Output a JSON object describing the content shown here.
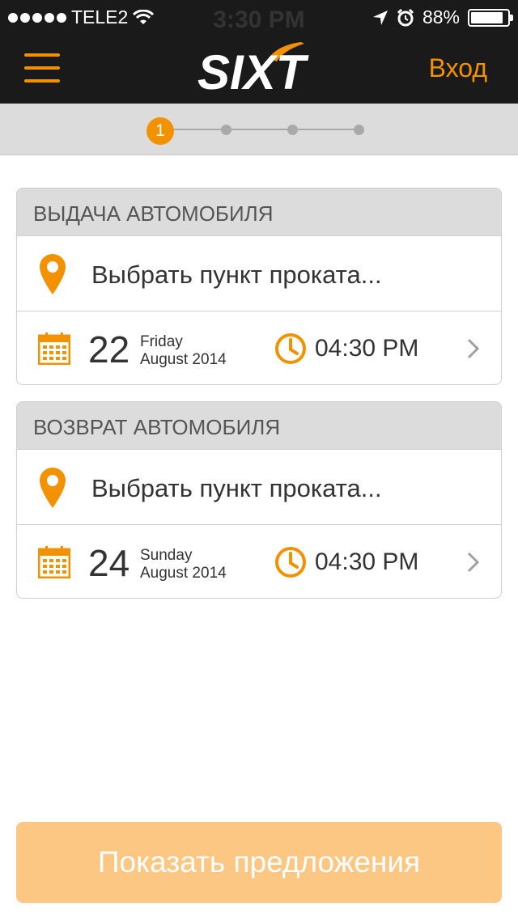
{
  "status_bar": {
    "carrier": "TELE2",
    "time": "3:30 PM",
    "battery": "88%",
    "battery_level": 0.88
  },
  "nav": {
    "logo_text": "SIXT",
    "login_label": "Вход"
  },
  "stepper": {
    "current_step": "1",
    "total_steps": 4
  },
  "pickup": {
    "header": "ВЫДАЧА АВТОМОБИЛЯ",
    "location_placeholder": "Выбрать пункт проката...",
    "day": "22",
    "weekday": "Friday",
    "month_year": "August 2014",
    "time": "04:30 PM"
  },
  "return": {
    "header": "ВОЗВРАТ АВТОМОБИЛЯ",
    "location_placeholder": "Выбрать пункт проката...",
    "day": "24",
    "weekday": "Sunday",
    "month_year": "August 2014",
    "time": "04:30 PM"
  },
  "cta": {
    "label": "Показать предложения"
  },
  "colors": {
    "accent": "#f39200",
    "cta_disabled": "#fbc783",
    "header_bg": "#1a1a1a"
  },
  "icons": [
    "menu-icon",
    "location-pin-icon",
    "calendar-icon",
    "clock-icon",
    "chevron-right-icon",
    "wifi-icon",
    "location-arrow-icon",
    "alarm-icon",
    "battery-icon"
  ]
}
